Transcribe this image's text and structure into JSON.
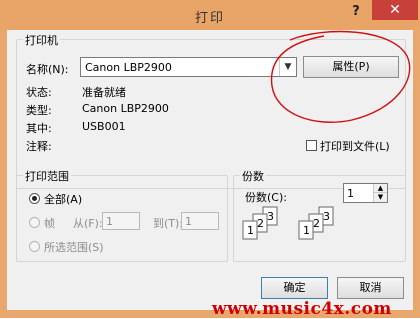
{
  "window": {
    "title": "打印",
    "help_label": "?",
    "close_label": "✕"
  },
  "printer_group": {
    "label": "打印机",
    "name_label": "名称(N):",
    "name_value": "Canon LBP2900",
    "properties_button": "属性(P)",
    "status_label": "状态:",
    "status_value": "准备就绪",
    "type_label": "类型:",
    "type_value": "Canon LBP2900",
    "where_label": "其中:",
    "where_value": "USB001",
    "comment_label": "注释:",
    "print_to_file_label": "打印到文件(L)",
    "print_to_file_checked": false
  },
  "range_group": {
    "label": "打印范围",
    "all_label": "全部(A)",
    "frames_label": "帧",
    "from_label": "从(F):",
    "from_value": "1",
    "to_label": "到(T):",
    "to_value": "1",
    "selection_label": "所选范围(S)",
    "selected": "all"
  },
  "copies_group": {
    "label": "份数",
    "copies_label": "份数(C):",
    "copies_value": "1",
    "collate_digits": [
      "1",
      "2",
      "3"
    ]
  },
  "actions": {
    "ok_label": "确定",
    "cancel_label": "取消"
  },
  "watermark": {
    "text": "www.music4x.com",
    "color": "#d10000"
  },
  "annotation": {
    "color": "#d01010"
  }
}
